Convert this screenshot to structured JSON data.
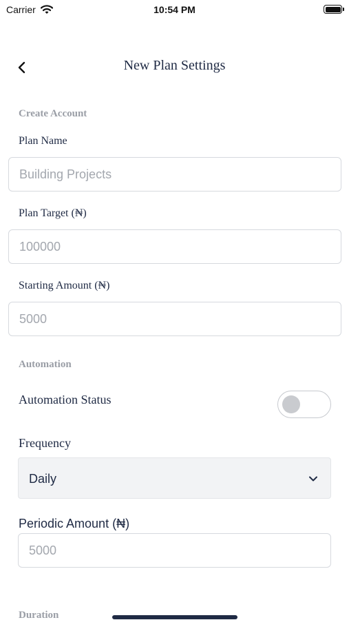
{
  "status_bar": {
    "carrier": "Carrier",
    "time": "10:54 PM",
    "wifi_icon": "wifi-icon",
    "battery_icon": "battery-icon"
  },
  "header": {
    "title": "New Plan Settings",
    "back_icon": "chevron-left-icon"
  },
  "create_account": {
    "section_title": "Create Account",
    "plan_name": {
      "label": "Plan Name",
      "placeholder": "Building Projects"
    },
    "plan_target": {
      "label": "Plan Target (₦)",
      "placeholder": "100000"
    },
    "starting_amount": {
      "label": "Starting Amount (₦)",
      "placeholder": "5000"
    }
  },
  "automation": {
    "section_title": "Automation",
    "status_label": "Automation Status",
    "status_on": false,
    "frequency": {
      "label": "Frequency",
      "selected": "Daily",
      "icon": "chevron-down-icon"
    },
    "periodic_amount": {
      "label": "Periodic Amount (₦)",
      "placeholder": "5000"
    }
  },
  "duration": {
    "section_title": "Duration"
  },
  "colors": {
    "text_primary": "#1f2a44",
    "section_gray": "#9a9ea6",
    "input_border": "#d6d9de",
    "select_bg": "#f2f3f5"
  }
}
